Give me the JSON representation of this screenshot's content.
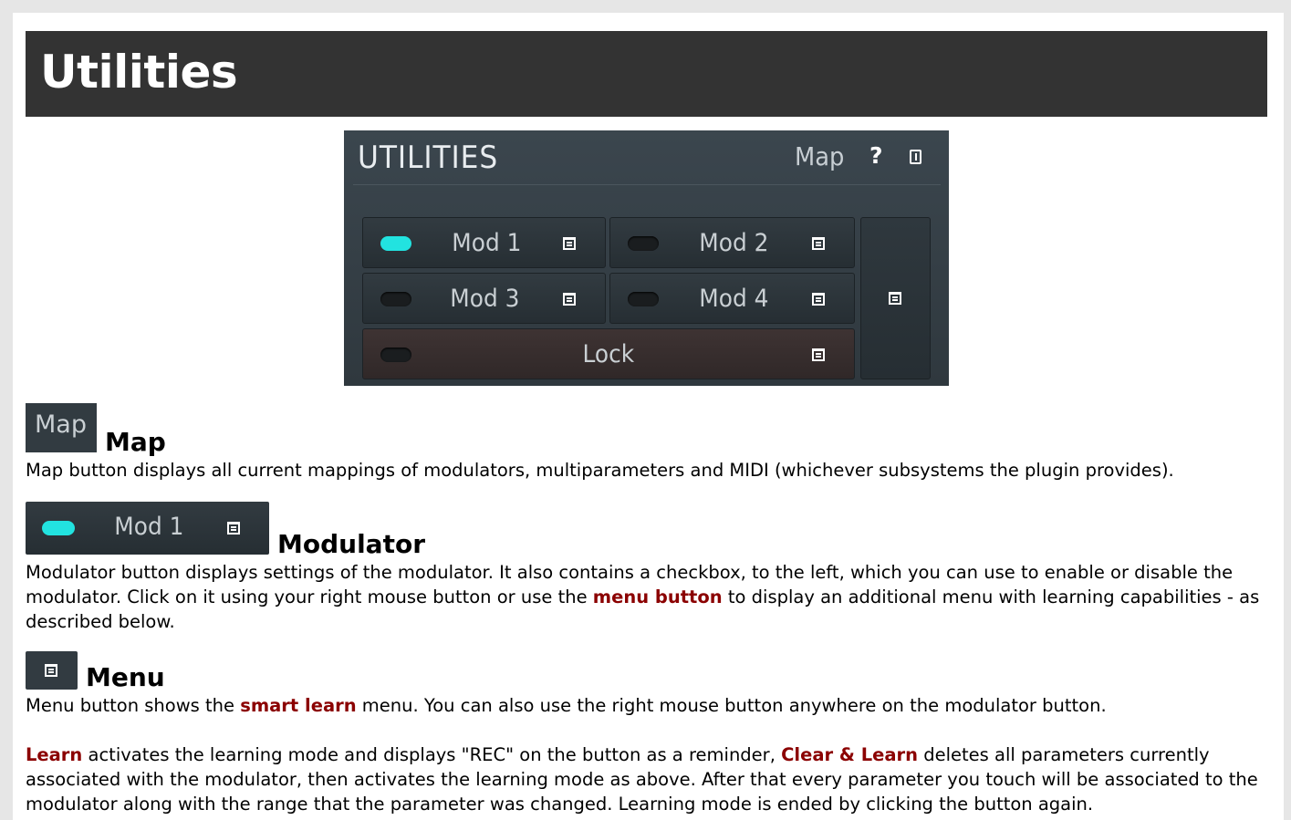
{
  "page_title": "Utilities",
  "panel": {
    "title": "UTILITIES",
    "map_label": "Map",
    "help_label": "?",
    "modulators": [
      {
        "label": "Mod 1",
        "enabled": true
      },
      {
        "label": "Mod 2",
        "enabled": false
      },
      {
        "label": "Mod 3",
        "enabled": false
      },
      {
        "label": "Mod 4",
        "enabled": false
      }
    ],
    "lock_label": "Lock",
    "accent_color": "#22e3e0"
  },
  "sections": {
    "map": {
      "thumb_label": "Map",
      "heading": "Map",
      "text": "Map button displays all current mappings of modulators, multiparameters and MIDI (whichever subsystems the plugin provides)."
    },
    "modulator": {
      "thumb_label": "Mod 1",
      "heading": "Modulator",
      "text_1": "Modulator button displays settings of the modulator. It also contains a checkbox, to the left, which you can use to enable or disable the modulator. Click on it using your right mouse button or use the ",
      "link": "menu button",
      "text_2": " to display an additional menu with learning capabilities - as described below."
    },
    "menu": {
      "heading": "Menu",
      "text_1": "Menu button shows the ",
      "link": "smart learn",
      "text_2": " menu. You can also use the right mouse button anywhere on the modulator button."
    },
    "learn": {
      "link_1": "Learn",
      "text_1": " activates the learning mode and displays \"REC\" on the button as a reminder, ",
      "link_2": "Clear & Learn",
      "text_2": " deletes all parameters currently associated with the modulator, then activates the learning mode as above. After that every parameter you touch will be associated to the modulator along with the range that the parameter was changed. Learning mode is ended by clicking the button again."
    }
  }
}
